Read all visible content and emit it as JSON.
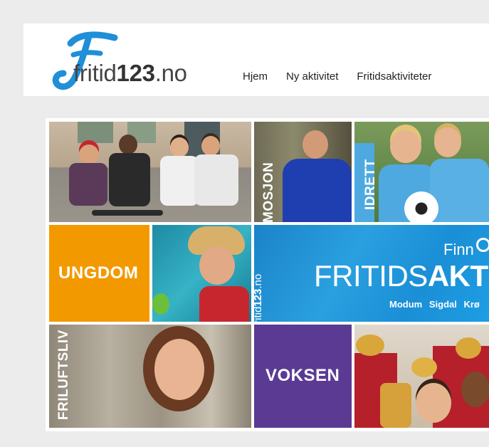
{
  "header": {
    "logo": {
      "prefix": "fritid",
      "number": "123",
      "suffix": ".no",
      "icon": "f-swirl-logo-icon"
    },
    "nav": [
      {
        "label": "Hjem"
      },
      {
        "label": "Ny aktivitet"
      },
      {
        "label": "Fritidsaktiviteter"
      }
    ]
  },
  "tiles": {
    "mosjon": "MOSJON",
    "idrett": "IDRETT",
    "ungdom": "UNGDOM",
    "friluftsliv": "FRILUFTSLIV",
    "voksen": "VOKSEN",
    "banner": {
      "side_text_prefix": "fritid",
      "side_text_number": "123",
      "side_text_suffix": ".no",
      "finn": "Finn",
      "title_light": "FRITIDS",
      "title_bold": "AKTIV",
      "places": [
        "Modum",
        "Sigdal",
        "Krø"
      ],
      "search_icon": "magnifier-icon"
    }
  },
  "colors": {
    "orange": "#f29900",
    "purple": "#5b3a93",
    "blue": "#1a8fd6",
    "logo_blue": "#1f8fd8"
  }
}
